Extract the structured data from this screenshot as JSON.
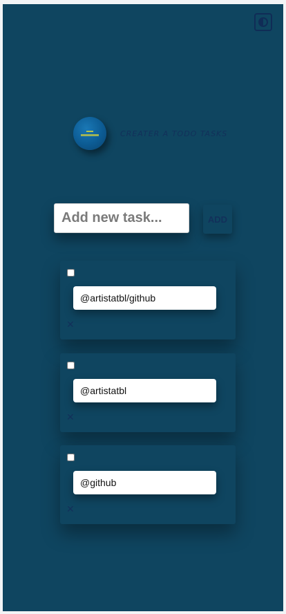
{
  "theme_toggle": {
    "icon": "contrast-icon"
  },
  "brand": {
    "title": "CREATER A TODO TASKS"
  },
  "new_task": {
    "placeholder": "Add new task...",
    "value": ""
  },
  "add_button": {
    "label": "ADD"
  },
  "todos": [
    {
      "text": "@artistatbl/github",
      "checked": false,
      "delete_label": "✕"
    },
    {
      "text": "@artistatbl",
      "checked": false,
      "delete_label": "✕"
    },
    {
      "text": "@github",
      "checked": false,
      "delete_label": "✕"
    }
  ],
  "colors": {
    "background": "#0f4560",
    "accent": "#12305a",
    "field": "#ffffff"
  }
}
